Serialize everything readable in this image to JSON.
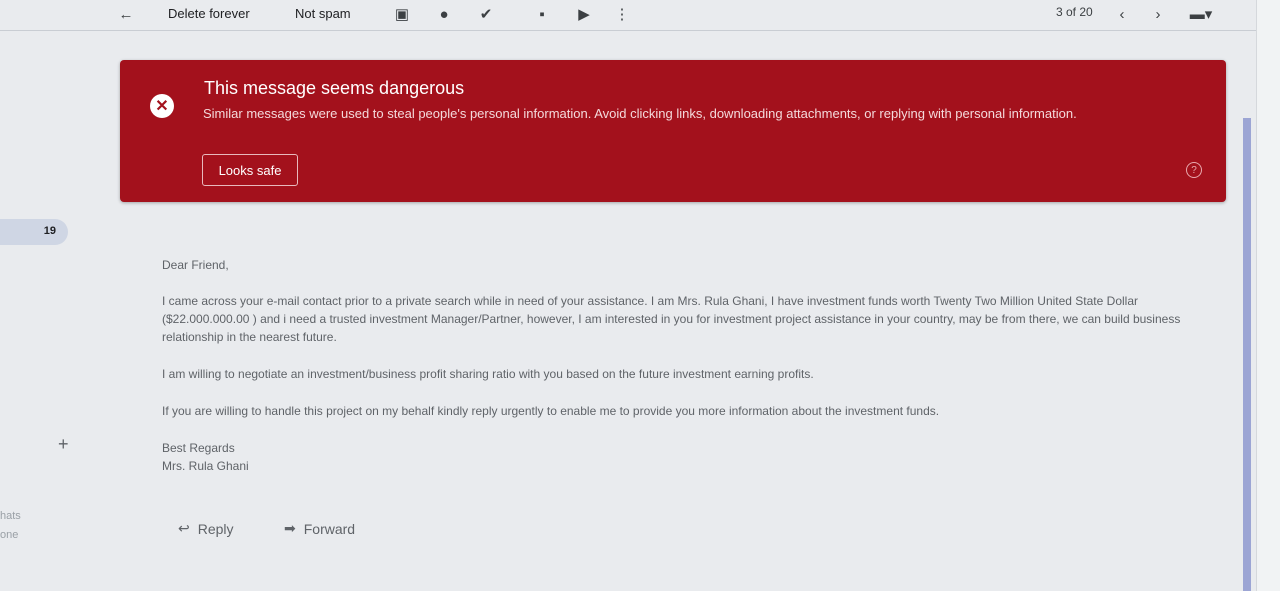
{
  "toolbar": {
    "delete_forever": "Delete forever",
    "not_spam": "Not spam",
    "pager": "3 of 20"
  },
  "sidebar": {
    "badge_count": "19",
    "chats_label": "hats",
    "status_label": "one"
  },
  "warning": {
    "title": "This message seems dangerous",
    "description": "Similar messages were used to steal people's personal information. Avoid clicking links, downloading attachments, or replying with personal information.",
    "looks_safe": "Looks safe"
  },
  "email": {
    "greeting": "Dear Friend,",
    "paragraph1": "I came across your e-mail contact prior to a private search while in need of your assistance. I am Mrs. Rula Ghani, I have investment funds worth Twenty Two Million United State Dollar ($22.000.000.00 ) and i need a trusted investment Manager/Partner, however, I am interested in you for investment project assistance in your country, may be from there, we can build business relationship in the nearest future.",
    "paragraph2": "I am willing to negotiate an investment/business profit sharing ratio with you based on the future investment earning profits.",
    "paragraph3": "If you are willing to handle this project on my behalf kindly reply urgently to enable me to provide you more information about the investment funds.",
    "closing": "Best Regards",
    "signature": "Mrs. Rula Ghani"
  },
  "actions": {
    "reply": "Reply",
    "forward": "Forward"
  },
  "icons": [
    "back-arrow-icon",
    "archive-icon",
    "snooze-icon",
    "add-task-icon",
    "move-icon",
    "label-icon",
    "more-vert-icon",
    "prev-icon",
    "next-icon",
    "input-tools-icon",
    "plus-icon",
    "help-icon",
    "close-icon",
    "reply-icon",
    "forward-icon"
  ]
}
